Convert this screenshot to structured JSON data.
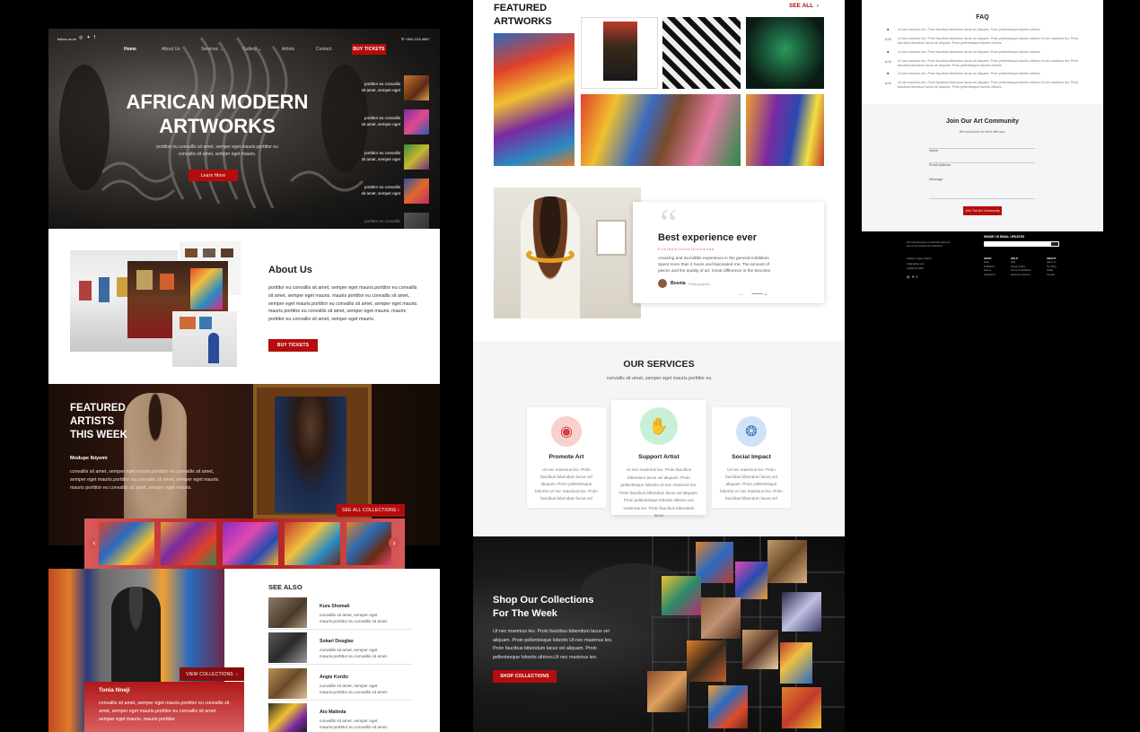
{
  "c1": {
    "hero": {
      "follow": "follow us on",
      "phone": "+000-123-4567",
      "nav": [
        "Home",
        "About Us",
        "Services",
        "Gallery",
        "Artists",
        "Contact"
      ],
      "nav_arrows": [
        "",
        "",
        "⌄",
        "⌄",
        "",
        ""
      ],
      "cta": "BUY TICKETS",
      "title1": "AFRICAN MODERN",
      "title2": "ARTWORKS",
      "sub1": "porttitor eu convallis sit amet, semper eget mauris.porttitor eu",
      "sub2": "convallis sit amet, semper eget mauris.",
      "learn": "Learn More",
      "side": [
        {
          "a": "porttitor eu convallis",
          "b": "sit amet, semper eget"
        },
        {
          "a": "porttitor eu convallis",
          "b": "sit amet, semper eget"
        },
        {
          "a": "porttitor eu convallis",
          "b": "sit amet, semper eget"
        },
        {
          "a": "porttitor eu convallis",
          "b": "sit amet, semper eget"
        },
        {
          "a": "porttitor eu convallis",
          "b": ""
        }
      ]
    },
    "about": {
      "title": "About Us",
      "body": "porttitor eu convallis sit amet, semper eget mauris.porttitor eu convallis sit amet, semper eget mauris. mauris porttitor eu convallis sit amet, semper eget mauris.porttitor eu convallis sit amet, semper eget mauris. mauris porttitor eu convallis sit amet, semper eget mauris. mauris porttitor eu convallis sit amet, semper eget mauris.",
      "btn": "BUY TICKETS"
    },
    "featured": {
      "t1": "FEATURED",
      "t2": "ARTISTS",
      "t3": "THIS WEEK",
      "name": "Modupe Ibiyemi",
      "body": "convallis sit amet, semper eget mauris.porttitor eu convallis sit amet, semper eget mauris.porttitor eu convallis sit amet, semper eget mauris. mauris porttitor eu convallis sit amet, semper eget mauris.",
      "see_all": "SEE ALL COLLECTIONS",
      "prev": "‹",
      "next": "›"
    },
    "seealso": {
      "title": "SEE  ALSO",
      "items": [
        {
          "name": "Kura Shomali",
          "d1": "convallis sit amet, semper eget",
          "d2": "mauris.porttitor eu convallis sit amet."
        },
        {
          "name": "Sokari Douglas",
          "d1": "convallis sit amet, semper eget",
          "d2": "mauris.porttitor eu convallis sit amet."
        },
        {
          "name": "Angie Kordic",
          "d1": "convallis sit amet, semper eget",
          "d2": "mauris.porttitor eu convallis sit amet."
        },
        {
          "name": "Ato Malinda",
          "d1": "convallis sit amet, semper eget",
          "d2": "mauris.porttitor eu convallis sit amet."
        }
      ],
      "view": "VIEW COLLECTIONS",
      "artist": "Tonia Nneji",
      "artist_body": "convallis sit amet, semper eget mauris.porttitor eu convallis sit amet, semper eget mauris.porttitor eu convallis sit amet, semper eget mauris. mauris porttitor"
    }
  },
  "c2": {
    "fa": {
      "t1": "FEATURED",
      "t2": "ARTWORKS",
      "see": "SEE  ALL"
    },
    "testi": {
      "quote": "“",
      "title": "Best experience ever",
      "sub": "Fostepalisbutisfeeddas",
      "body": "Amazing and incredible experience in the general exhibition. Spent more than 4 hours and fascinated me. The amount of pieces and the quality of art. Great difference in the benches",
      "name": "Bosnia",
      "role": "Photographer"
    },
    "services": {
      "title": "OUR SERVICES",
      "sub": "convallis sit amet, semper eget mauris.porttitor eu",
      "cards": [
        {
          "title": "Promote Art",
          "body": "Ut nec maximus leo. Proin faucibus bibendum lacus vel aliquam. Proin pellentesque lobortis Ut nec maximus leo. Proin faucibus bibendum lacus vel"
        },
        {
          "title": "Support Artist",
          "body": "Ut nec maximus leo. Proin faucibus bibendum lacus vel aliquam. Proin pellentesque lobortis Ut nec maximus leo. Proin faucibus bibendum lacus vel aliquam. Proin pellentesque lobortis ultrices nec maximus leo. Proin faucibus bibendum lacus"
        },
        {
          "title": "Social Impact",
          "body": "Ut nec maximus leo. Proin faucibus bibendum lacus vel aliquam. Proin pellentesque lobortis Ut nec maximus leo. Proin faucibus bibendum lacus vel"
        }
      ]
    },
    "shop": {
      "t1": "Shop Our Collections",
      "t2": "For The Week",
      "body": "Ut nec maximus leo. Proin faucibus bibendum lacus vel aliquam. Proin pellentesque lobortis Ut nec maximus leo. Proin faucibus bibendum lacus vel aliquam. Proin pellentesque lobortis ultrices.Ut nec maximus leo.",
      "btn": "SHOP COLLECTIONS"
    }
  },
  "c3": {
    "faq": {
      "title": "FAQ",
      "rows": [
        {
          "m": "●",
          "t1": "Ut nec maximus leo. Proin faucibus bibendum lacus vel aliquam. Proin pellentesque lobortis ultrices.",
          "t2": ""
        },
        {
          "m": "A:N",
          "t1": "Ut nec maximus leo. Proin faucibus bibendum lacus vel aliquam. Proin pellentesque lobortis ultrices Ut nec maximus leo. Proin",
          "t2": "faucibus bibendum lacus vel aliquam. Proin pellentesque lobortis ultrices."
        },
        {
          "m": "●",
          "t1": "Ut nec maximus leo. Proin faucibus bibendum lacus vel aliquam. Proin pellentesque lobortis ultrices.",
          "t2": ""
        },
        {
          "m": "A:N",
          "t1": "Ut nec maximus leo. Proin faucibus bibendum lacus vel aliquam. Proin pellentesque lobortis ultrices Ut nec maximus leo. Proin",
          "t2": "faucibus bibendum lacus vel aliquam. Proin pellentesque lobortis ultrices."
        },
        {
          "m": "●",
          "t1": "Ut nec maximus leo. Proin faucibus bibendum lacus vel aliquam. Proin pellentesque lobortis ultrices.",
          "t2": ""
        },
        {
          "m": "A:N",
          "t1": "Ut nec maximus leo. Proin faucibus bibendum lacus vel aliquam. Proin pellentesque lobortis ultrices Ut nec maximus leo. Proin",
          "t2": "faucibus bibendum lacus vel aliquam. Proin pellentesque lobortis ultrices."
        }
      ]
    },
    "join": {
      "title": "Join Our Art Community",
      "sub": "We would love to meet with you.",
      "name": "Name",
      "email": "Email Address",
      "msg": "Message",
      "btn": "Join The Art Community"
    },
    "footer": {
      "news": "INSIDE US EMAIL UPDATES",
      "about1": "We Invite Everyone to Celebrate Africa Art",
      "about2": "Join us and explore the collections",
      "addr1": "Address: Lagos, Nigeria",
      "addr2": "info@gallery.com",
      "addr3": "+0000-123-4567",
      "cols": [
        {
          "h": "SHOP",
          "l": [
            "Shop",
            "Exhibitions",
            "Events",
            "Collections"
          ]
        },
        {
          "h": "HELP",
          "l": [
            "FAQ",
            "Privacy Policy",
            "Terms & Conditions",
            "Refunds & Returns"
          ]
        },
        {
          "h": "ABOUT",
          "l": [
            "About us",
            "Our Story",
            "Artists",
            "Contact"
          ]
        }
      ]
    }
  }
}
